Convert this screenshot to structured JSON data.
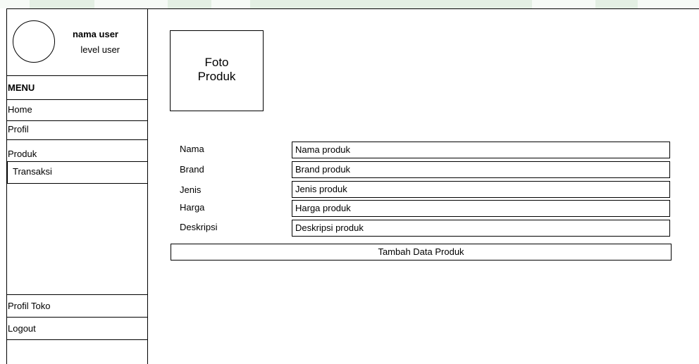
{
  "user": {
    "name": "nama user",
    "level": "level user"
  },
  "menu": {
    "heading": "MENU",
    "items": [
      "Home",
      "Profil",
      "Produk",
      "Transaksi"
    ],
    "bottom_items": [
      "Profil Toko",
      "Logout"
    ]
  },
  "photo": {
    "line1": "Foto",
    "line2": "Produk"
  },
  "form": {
    "fields": [
      {
        "label": "Nama",
        "value": "Nama produk"
      },
      {
        "label": "Brand",
        "value": "Brand produk"
      },
      {
        "label": "Jenis",
        "value": "Jenis produk"
      },
      {
        "label": "Harga",
        "value": "Harga produk"
      },
      {
        "label": "Deskripsi",
        "value": "Deskripsi produk"
      }
    ],
    "submit_label": "Tambah Data Produk"
  },
  "colors": {
    "strip": "#e3efe3",
    "border": "#000000"
  }
}
